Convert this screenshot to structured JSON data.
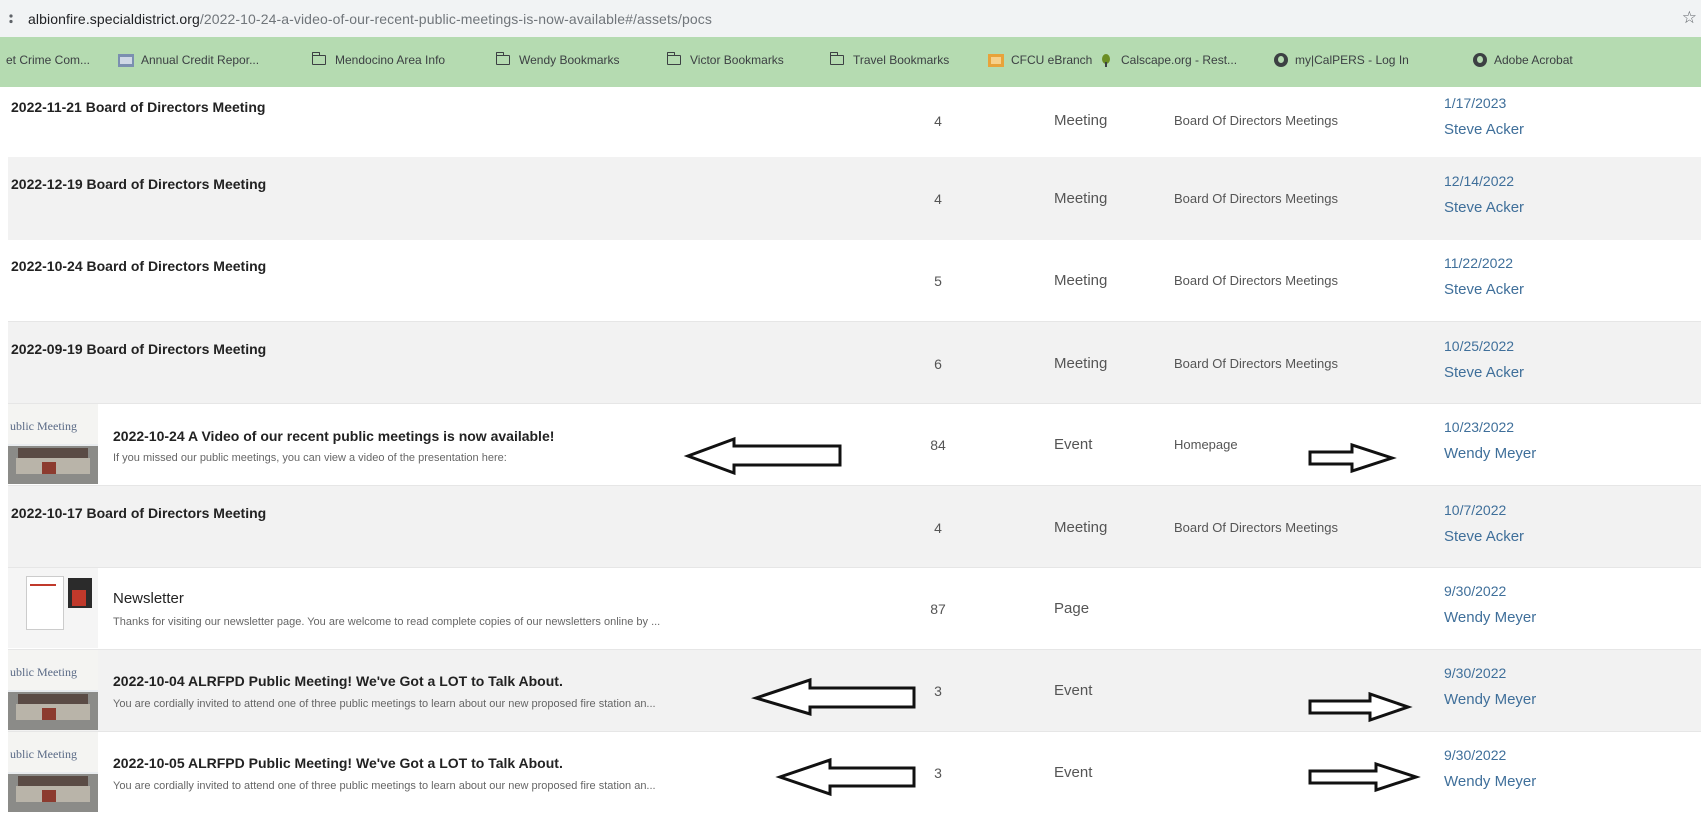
{
  "address_bar": {
    "host": "albionfire.specialdistrict.org",
    "path": "/2022-10-24-a-video-of-our-recent-public-meetings-is-now-available#/assets/pocs"
  },
  "bookmarks": [
    {
      "label": "et Crime Com...",
      "icon": "crime-icon"
    },
    {
      "label": "Annual Credit Repor...",
      "icon": "credit-icon"
    },
    {
      "label": "Mendocino Area Info",
      "icon": "folder-icon"
    },
    {
      "label": "Wendy Bookmarks",
      "icon": "folder-icon"
    },
    {
      "label": "Victor Bookmarks",
      "icon": "folder-icon"
    },
    {
      "label": "Travel Bookmarks",
      "icon": "folder-icon"
    },
    {
      "label": "CFCU eBranch",
      "icon": "cfcu-icon"
    },
    {
      "label": "Calscape.org - Rest...",
      "icon": "calscape-icon"
    },
    {
      "label": "my|CalPERS - Log In",
      "icon": "globe-icon"
    },
    {
      "label": "Adobe Acrobat",
      "icon": "globe-icon"
    }
  ],
  "thumb_label": "ublic Meeting",
  "rows": [
    {
      "title": "2022-11-21 Board of Directors Meeting",
      "desc": "",
      "count": "4",
      "type": "Meeting",
      "category": "Board Of Directors Meetings",
      "date": "1/17/2023",
      "author": "Steve Acker"
    },
    {
      "title": "2022-12-19 Board of Directors Meeting",
      "desc": "",
      "count": "4",
      "type": "Meeting",
      "category": "Board Of Directors Meetings",
      "date": "12/14/2022",
      "author": "Steve Acker"
    },
    {
      "title": "2022-10-24 Board of Directors Meeting",
      "desc": "",
      "count": "5",
      "type": "Meeting",
      "category": "Board Of Directors Meetings",
      "date": "11/22/2022",
      "author": "Steve Acker"
    },
    {
      "title": "2022-09-19 Board of Directors Meeting",
      "desc": "",
      "count": "6",
      "type": "Meeting",
      "category": "Board Of Directors Meetings",
      "date": "10/25/2022",
      "author": "Steve Acker"
    },
    {
      "title": "2022-10-24 A Video of our recent public meetings is now available!",
      "desc": "If you missed our public meetings, you can view a video of the presentation here:",
      "count": "84",
      "type": "Event",
      "category": "Homepage",
      "date": "10/23/2022",
      "author": "Wendy Meyer"
    },
    {
      "title": "2022-10-17 Board of Directors Meeting",
      "desc": "",
      "count": "4",
      "type": "Meeting",
      "category": "Board Of Directors Meetings",
      "date": "10/7/2022",
      "author": "Steve Acker"
    },
    {
      "title": "Newsletter",
      "desc": "Thanks for visiting our newsletter page.  You are welcome to read complete copies of our newsletters online by ...",
      "count": "87",
      "type": "Page",
      "category": "",
      "date": "9/30/2022",
      "author": "Wendy Meyer"
    },
    {
      "title": "2022-10-04 ALRFPD Public Meeting!  We've Got a LOT to Talk About.",
      "desc": "You are cordially invited to attend one of three public meetings to learn about our new proposed fire station an...",
      "count": "3",
      "type": "Event",
      "category": "",
      "date": "9/30/2022",
      "author": "Wendy Meyer"
    },
    {
      "title": "2022-10-05 ALRFPD Public Meeting!  We've Got a LOT to Talk About.",
      "desc": "You are cordially invited to attend one of three public meetings to learn about our new proposed fire station an...",
      "count": "3",
      "type": "Event",
      "category": "",
      "date": "9/30/2022",
      "author": "Wendy Meyer"
    }
  ]
}
